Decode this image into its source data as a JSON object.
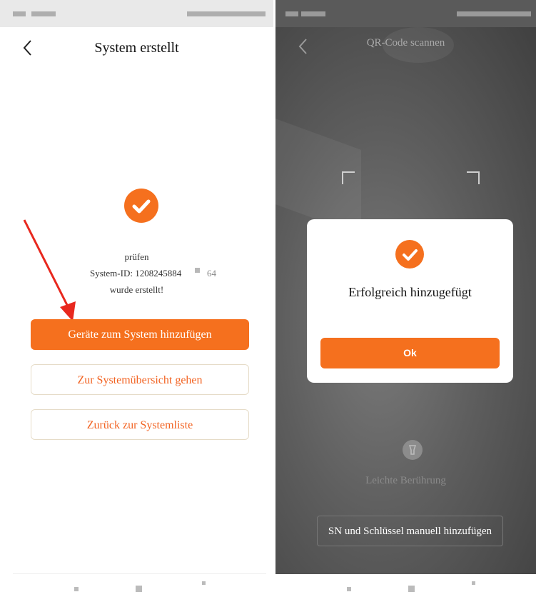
{
  "left": {
    "title": "System erstellt",
    "info": {
      "line1": "prüfen",
      "system_id": "System-ID: 1208245884",
      "suffix": "64",
      "line3": "wurde erstellt!"
    },
    "buttons": {
      "add_devices": "Geräte zum System hinzufügen",
      "overview": "Zur Systemübersicht gehen",
      "back_to_list": "Zurück zur Systemliste"
    }
  },
  "right": {
    "title": "QR-Code scannen",
    "dialog": {
      "message": "Erfolgreich hinzugefügt",
      "ok": "Ok"
    },
    "flash_label": "Leichte Berührung",
    "manual_button": "SN und Schlüssel manuell hinzufügen"
  },
  "colors": {
    "accent": "#f5701e",
    "arrow": "#e8281e"
  }
}
